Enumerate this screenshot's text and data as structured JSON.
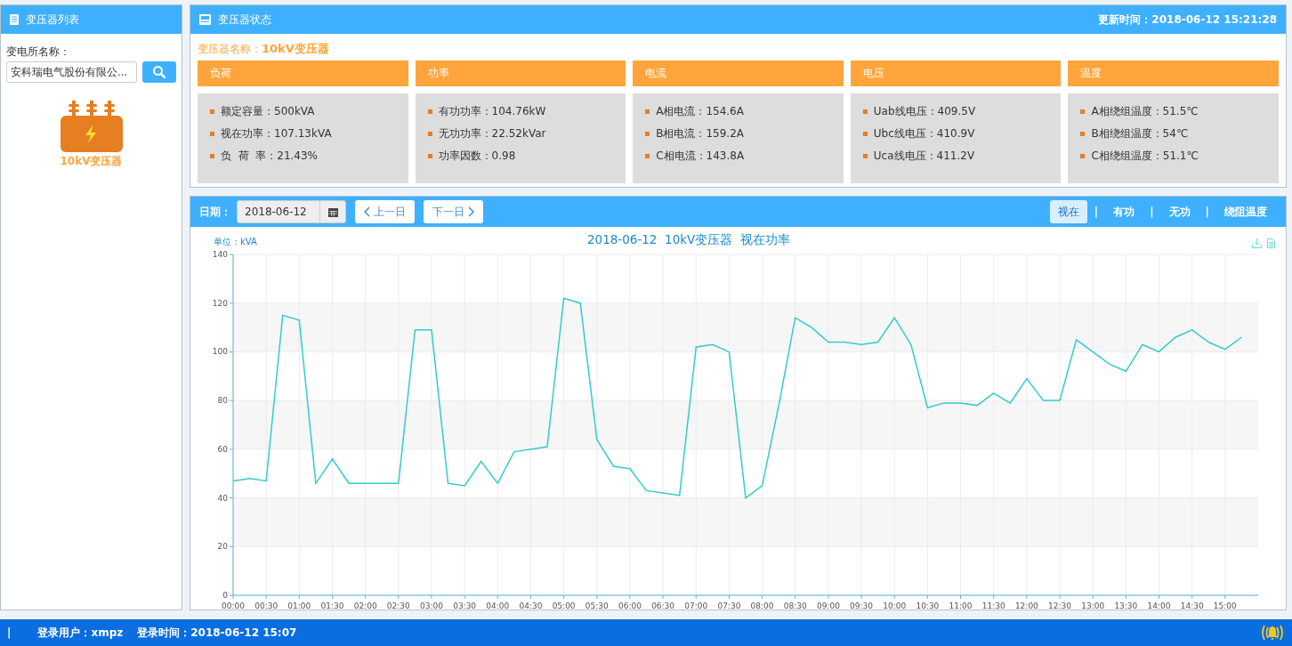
{
  "sidebar": {
    "title": "变压器列表",
    "field_label": "变电所名称：",
    "search_value": "安科瑞电气股份有限公...",
    "device_label": "10kV变压器"
  },
  "status": {
    "title": "变压器状态",
    "updated": "更新时间：2018-06-12 15:21:28",
    "name_label": "变压器名称：",
    "name_value": "10kV变压器",
    "cards": [
      {
        "title": "负荷",
        "lines": [
          "额定容量：500kVA",
          "视在功率：107.13kVA",
          "负  荷  率：21.43%"
        ]
      },
      {
        "title": "功率",
        "lines": [
          "有功功率：104.76kW",
          "无功功率：22.52kVar",
          "功率因数：0.98"
        ]
      },
      {
        "title": "电流",
        "lines": [
          "A相电流：154.6A",
          "B相电流：159.2A",
          "C相电流：143.8A"
        ]
      },
      {
        "title": "电压",
        "lines": [
          "Uab线电压：409.5V",
          "Ubc线电压：410.9V",
          "Uca线电压：411.2V"
        ]
      },
      {
        "title": "温度",
        "lines": [
          "A相绕组温度：51.5℃",
          "B相绕组温度：54℃",
          "C相绕组温度：51.1℃"
        ]
      }
    ]
  },
  "chart_panel": {
    "date_label": "日期：",
    "date_value": "2018-06-12",
    "prev_button": "上一日",
    "next_button": "下一日",
    "separator": "|",
    "tabs": [
      {
        "label": "视在",
        "selected": true
      },
      {
        "label": "有功",
        "selected": false
      },
      {
        "label": "无功",
        "selected": false
      },
      {
        "label": "绕阻温度",
        "selected": false
      }
    ],
    "chart_data": {
      "type": "line",
      "title": "2018-06-12  10kV变压器  视在功率",
      "ylabel": "单位：kVA",
      "x": [
        0,
        0.25,
        0.5,
        0.75,
        1,
        1.25,
        1.5,
        1.75,
        2,
        2.25,
        2.5,
        2.75,
        3,
        3.25,
        3.5,
        3.75,
        4,
        4.25,
        4.5,
        4.75,
        5,
        5.25,
        5.5,
        5.75,
        6,
        6.25,
        6.5,
        6.75,
        7,
        7.25,
        7.5,
        7.75,
        8,
        8.25,
        8.5,
        8.75,
        9,
        9.25,
        9.5,
        9.75,
        10,
        10.25,
        10.5,
        10.75,
        11,
        11.25,
        11.5,
        11.75,
        12,
        12.25,
        12.5,
        12.75,
        13,
        13.25,
        13.5,
        13.75,
        14,
        14.25,
        14.5,
        14.75,
        15,
        15.25
      ],
      "grid": true,
      "series": [
        {
          "color": "#33cccc",
          "values": [
            47,
            48,
            47,
            115,
            113,
            46,
            56,
            46,
            46,
            46,
            46,
            109,
            109,
            46,
            45,
            55,
            46,
            59,
            60,
            61,
            122,
            120,
            64,
            53,
            52,
            43,
            42,
            41,
            102,
            103,
            100,
            40,
            45,
            78,
            114,
            110,
            104,
            104,
            103,
            104,
            114,
            103,
            77,
            79,
            79,
            78,
            83,
            79,
            89,
            80,
            80,
            105,
            100,
            95,
            92,
            103,
            100,
            106,
            109,
            104,
            101,
            106
          ]
        }
      ],
      "ylim": [
        0,
        140
      ],
      "yticks": [
        0,
        20,
        40,
        60,
        80,
        100,
        120,
        140
      ],
      "xlim": [
        0,
        15.5
      ],
      "xticks": [
        {
          "value": 0,
          "label": "00:00"
        },
        {
          "value": 0.5,
          "label": "00:30"
        },
        {
          "value": 1,
          "label": "01:00"
        },
        {
          "value": 1.5,
          "label": "01:30"
        },
        {
          "value": 2,
          "label": "02:00"
        },
        {
          "value": 2.5,
          "label": "02:30"
        },
        {
          "value": 3,
          "label": "03:00"
        },
        {
          "value": 3.5,
          "label": "03:30"
        },
        {
          "value": 4,
          "label": "04:00"
        },
        {
          "value": 4.5,
          "label": "04:30"
        },
        {
          "value": 5,
          "label": "05:00"
        },
        {
          "value": 5.5,
          "label": "05:30"
        },
        {
          "value": 6,
          "label": "06:00"
        },
        {
          "value": 6.5,
          "label": "06:30"
        },
        {
          "value": 7,
          "label": "07:00"
        },
        {
          "value": 7.5,
          "label": "07:30"
        },
        {
          "value": 8,
          "label": "08:00"
        },
        {
          "value": 8.5,
          "label": "08:30"
        },
        {
          "value": 9,
          "label": "09:00"
        },
        {
          "value": 9.5,
          "label": "09:30"
        },
        {
          "value": 10,
          "label": "10:00"
        },
        {
          "value": 10.5,
          "label": "10:30"
        },
        {
          "value": 11,
          "label": "11:00"
        },
        {
          "value": 11.5,
          "label": "11:30"
        },
        {
          "value": 12,
          "label": "12:00"
        },
        {
          "value": 12.5,
          "label": "12:30"
        },
        {
          "value": 13,
          "label": "13:00"
        },
        {
          "value": 13.5,
          "label": "13:30"
        },
        {
          "value": 14,
          "label": "14:00"
        },
        {
          "value": 14.5,
          "label": "14:30"
        },
        {
          "value": 15,
          "label": "15:00"
        }
      ]
    }
  },
  "footer": {
    "separator": "|",
    "user": "登录用户：xmpz",
    "login_time": "登录时间：2018-06-12 15:07"
  }
}
